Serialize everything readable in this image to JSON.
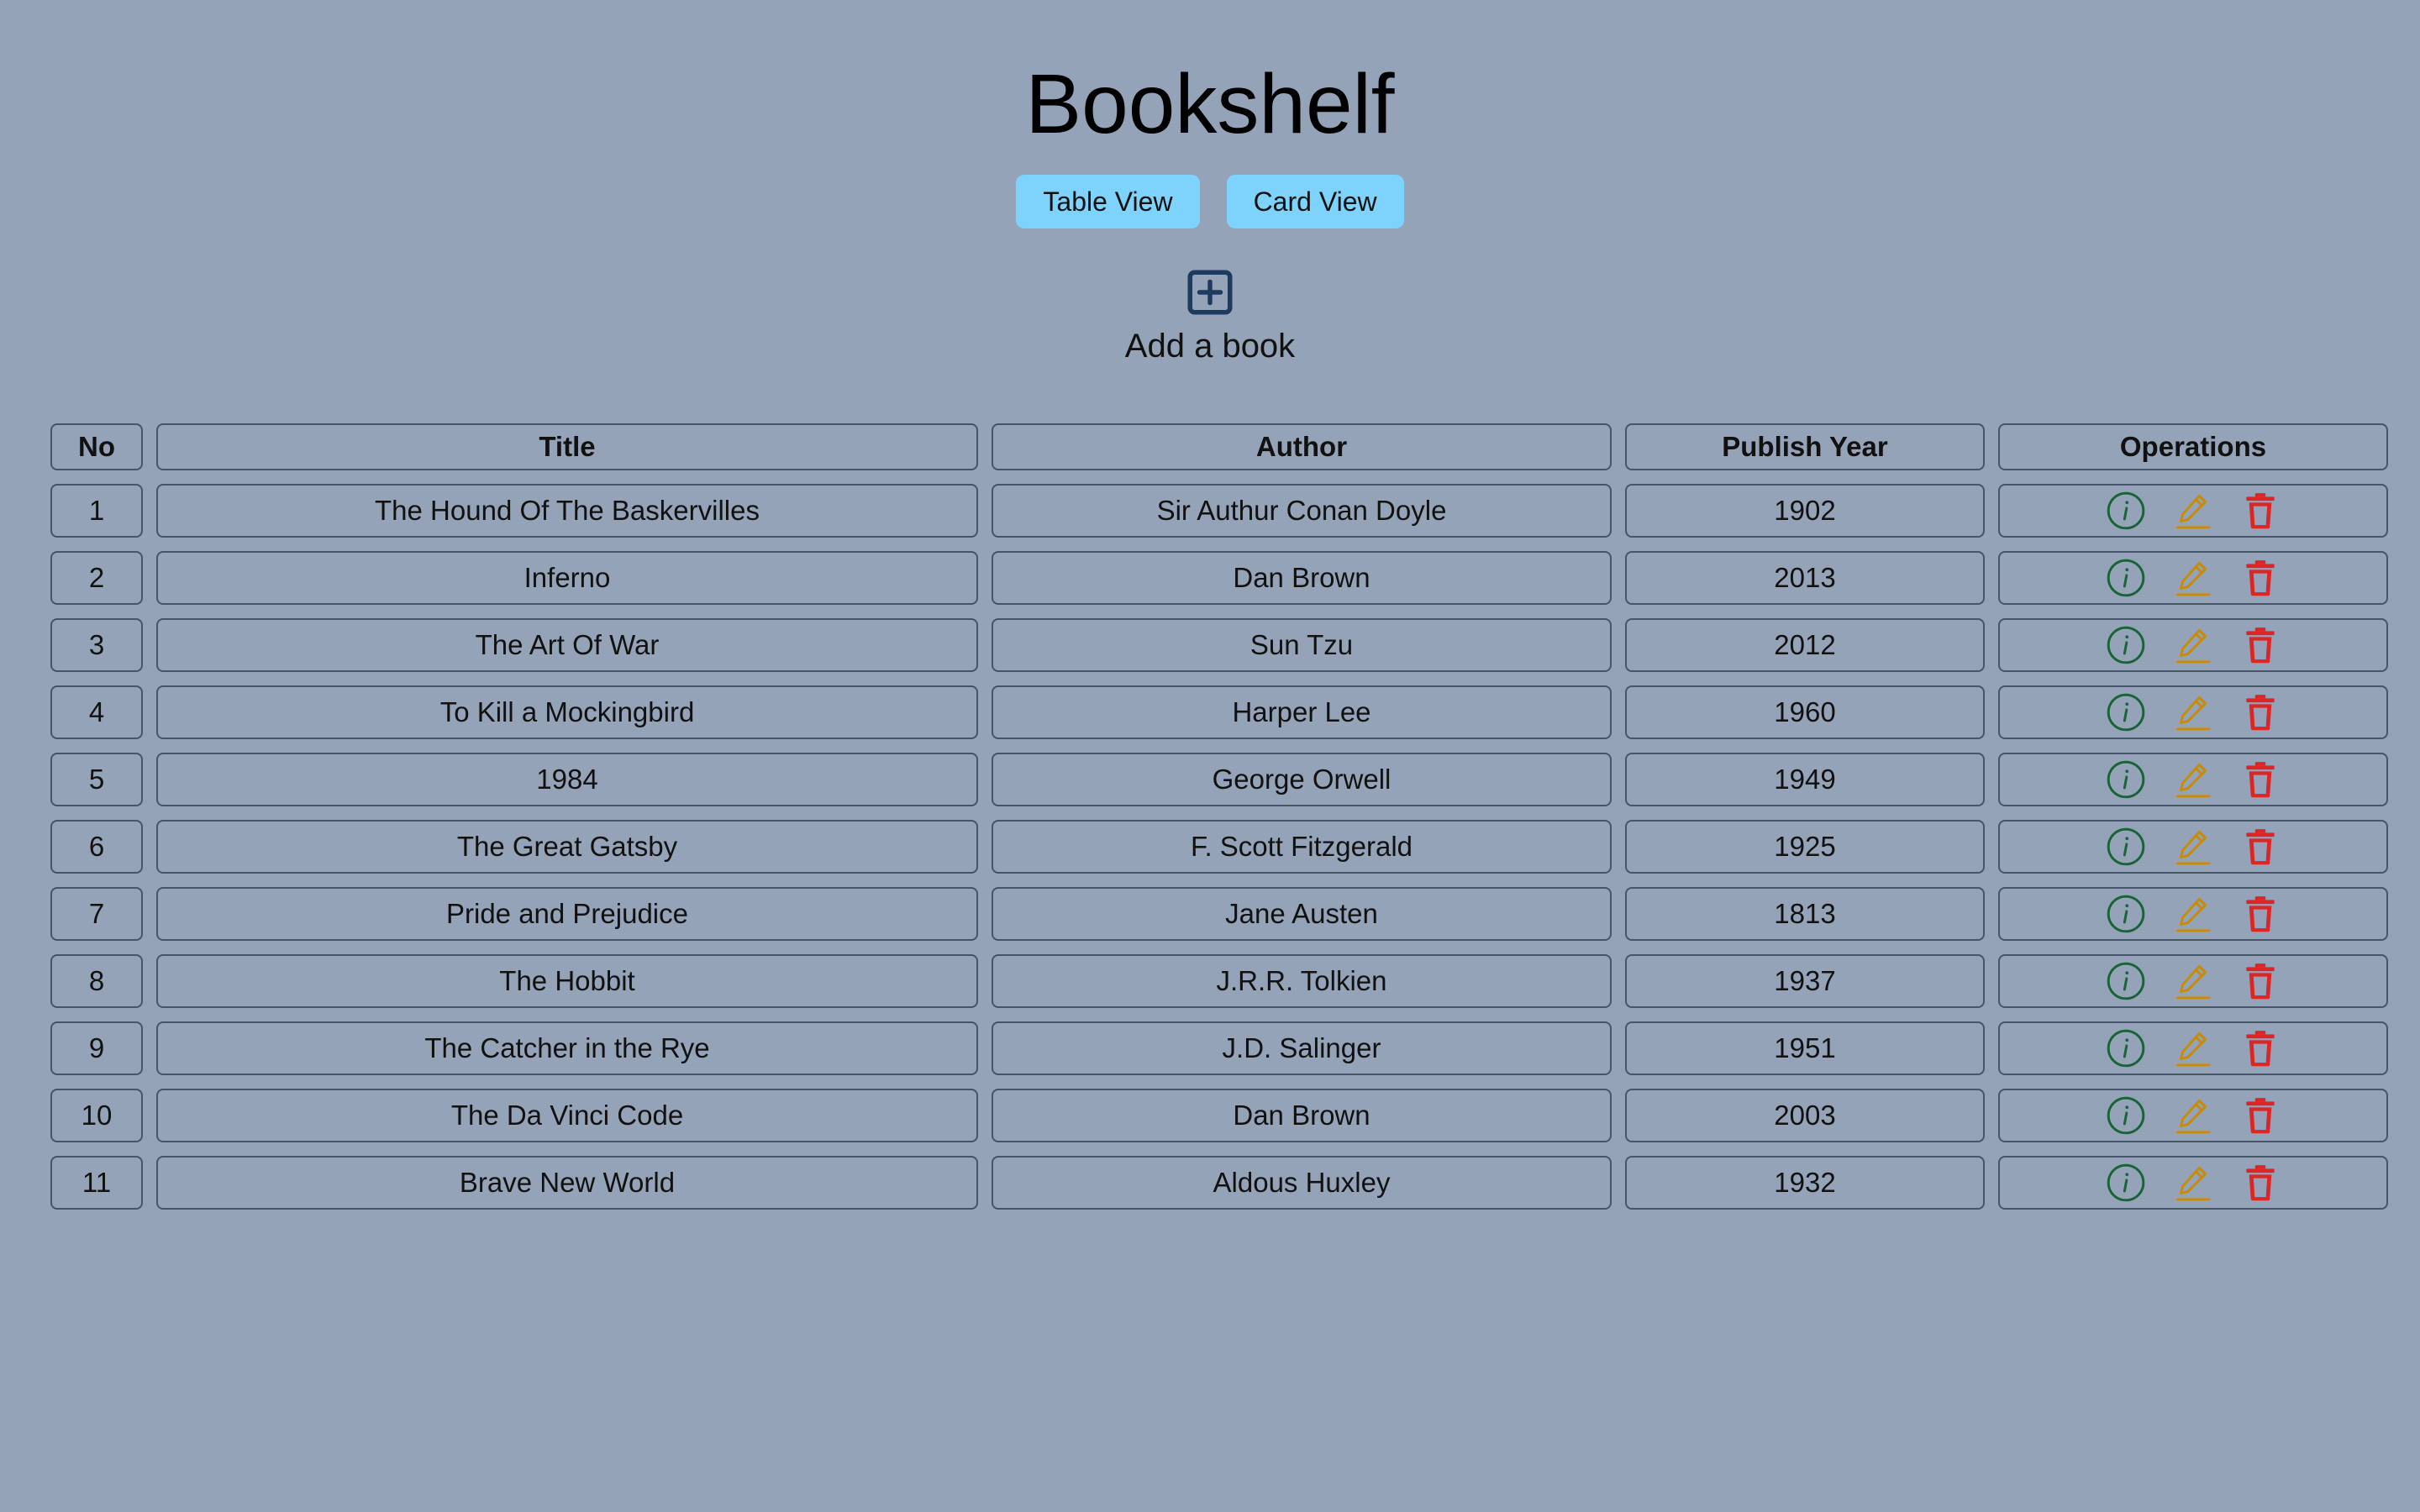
{
  "page": {
    "title": "Bookshelf",
    "background": "#94a3b8"
  },
  "view_toggle": {
    "table_label": "Table View",
    "card_label": "Card View",
    "button_color": "#7dd3fc"
  },
  "add_book": {
    "icon": "plus-square-icon",
    "label": "Add a book",
    "icon_color": "#1e3a5f"
  },
  "table": {
    "headers": {
      "no": "No",
      "title": "Title",
      "author": "Author",
      "year": "Publish Year",
      "operations": "Operations"
    },
    "operation_icons": {
      "info": {
        "icon": "info-circle-icon",
        "color": "#166534"
      },
      "edit": {
        "icon": "pencil-icon",
        "color": "#ca8a04"
      },
      "delete": {
        "icon": "trash-icon",
        "color": "#dc2626"
      }
    },
    "rows": [
      {
        "no": "1",
        "title": "The Hound Of The Baskervilles",
        "author": "Sir Authur Conan Doyle",
        "year": "1902"
      },
      {
        "no": "2",
        "title": "Inferno",
        "author": "Dan Brown",
        "year": "2013"
      },
      {
        "no": "3",
        "title": "The Art Of War",
        "author": "Sun Tzu",
        "year": "2012"
      },
      {
        "no": "4",
        "title": "To Kill a Mockingbird",
        "author": "Harper Lee",
        "year": "1960"
      },
      {
        "no": "5",
        "title": "1984",
        "author": "George Orwell",
        "year": "1949"
      },
      {
        "no": "6",
        "title": "The Great Gatsby",
        "author": "F. Scott Fitzgerald",
        "year": "1925"
      },
      {
        "no": "7",
        "title": "Pride and Prejudice",
        "author": "Jane Austen",
        "year": "1813"
      },
      {
        "no": "8",
        "title": "The Hobbit",
        "author": "J.R.R. Tolkien",
        "year": "1937"
      },
      {
        "no": "9",
        "title": "The Catcher in the Rye",
        "author": "J.D. Salinger",
        "year": "1951"
      },
      {
        "no": "10",
        "title": "The Da Vinci Code",
        "author": "Dan Brown",
        "year": "2003"
      },
      {
        "no": "11",
        "title": "Brave New World",
        "author": "Aldous Huxley",
        "year": "1932"
      }
    ]
  }
}
